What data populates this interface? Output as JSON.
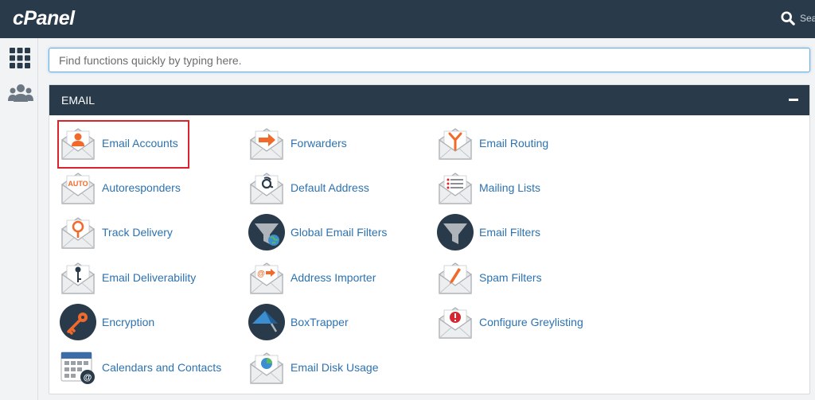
{
  "app": {
    "logo": "cPanel",
    "top_search_label": "Sea"
  },
  "sidebar": {
    "items": [
      {
        "icon": "grid-icon"
      },
      {
        "icon": "users-icon"
      }
    ]
  },
  "search": {
    "placeholder": "Find functions quickly by typing here."
  },
  "email_section": {
    "title": "EMAIL",
    "items": [
      {
        "label": "Email Accounts",
        "icon": "envelope-user-icon",
        "highlighted": true
      },
      {
        "label": "Forwarders",
        "icon": "envelope-arrow-icon"
      },
      {
        "label": "Email Routing",
        "icon": "envelope-routing-icon"
      },
      {
        "label": "Autoresponders",
        "icon": "envelope-auto-icon",
        "badge": "AUTO"
      },
      {
        "label": "Default Address",
        "icon": "envelope-at-icon"
      },
      {
        "label": "Mailing Lists",
        "icon": "envelope-list-icon"
      },
      {
        "label": "Track Delivery",
        "icon": "envelope-pin-icon"
      },
      {
        "label": "Global Email Filters",
        "icon": "globe-filter-icon"
      },
      {
        "label": "Email Filters",
        "icon": "filter-icon"
      },
      {
        "label": "Email Deliverability",
        "icon": "envelope-key-icon"
      },
      {
        "label": "Address Importer",
        "icon": "envelope-import-icon"
      },
      {
        "label": "Spam Filters",
        "icon": "envelope-pen-icon"
      },
      {
        "label": "Encryption",
        "icon": "key-icon"
      },
      {
        "label": "BoxTrapper",
        "icon": "boxtrapper-icon"
      },
      {
        "label": "Configure Greylisting",
        "icon": "envelope-alert-icon"
      },
      {
        "label": "Calendars and Contacts",
        "icon": "calendar-icon"
      },
      {
        "label": "Email Disk Usage",
        "icon": "envelope-chart-icon"
      }
    ]
  },
  "colors": {
    "header": "#293a4a",
    "link": "#2c72b0",
    "accent_orange": "#f26a2b",
    "highlight": "#d9232e"
  }
}
